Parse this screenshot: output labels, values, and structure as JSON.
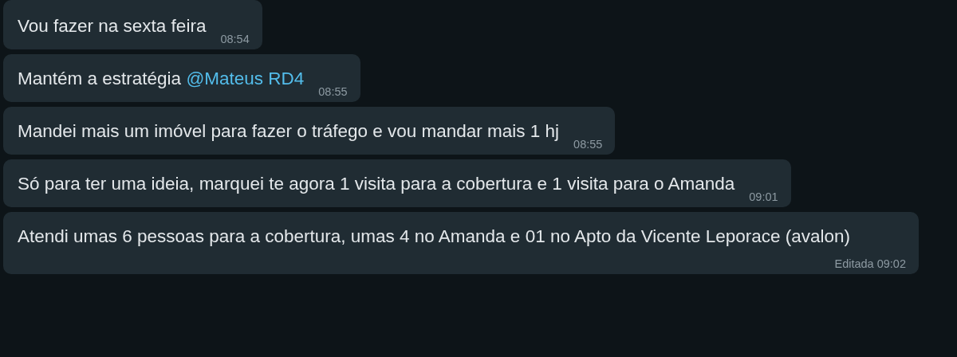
{
  "messages": [
    {
      "text": "Vou fazer na sexta feira",
      "time": "08:54"
    },
    {
      "text": "Mantém a estratégia",
      "mention": "@Mateus RD4",
      "time": "08:55"
    },
    {
      "text": "Mandei mais um imóvel para fazer o tráfego e vou mandar mais 1 hj",
      "time": "08:55"
    },
    {
      "text": "Só para ter uma ideia, marquei te agora 1 visita para a cobertura e 1 visita para o Amanda",
      "time": "09:01"
    },
    {
      "text": "Atendi umas 6 pessoas para a cobertura, umas 4 no Amanda e 01 no Apto da Vicente Leporace (avalon)",
      "edited_label": "Editada",
      "time": "09:02"
    }
  ]
}
